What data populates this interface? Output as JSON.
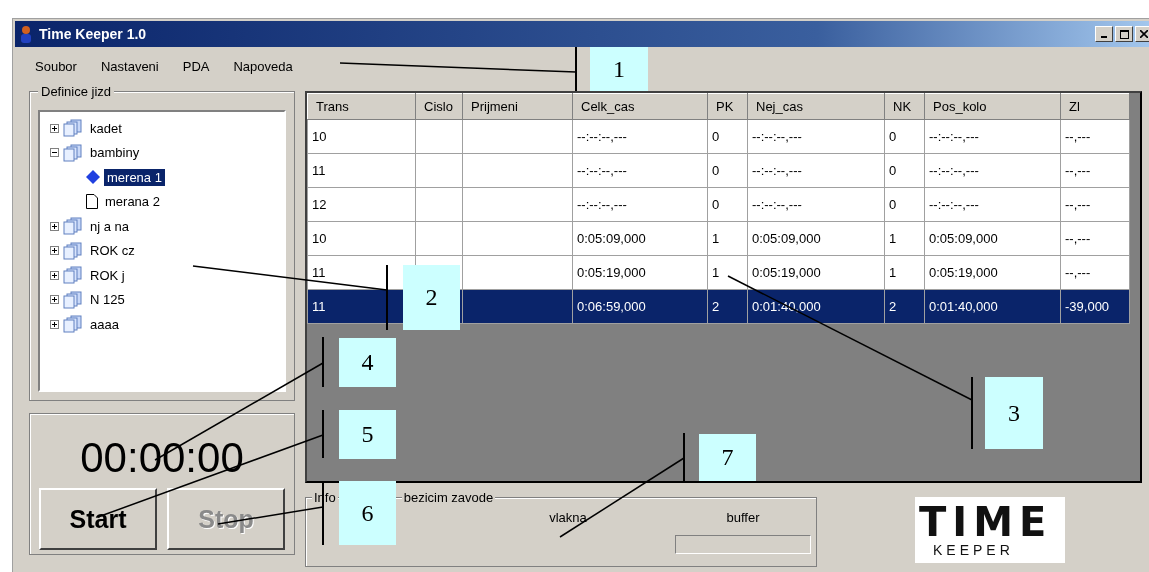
{
  "window": {
    "title": "Time Keeper 1.0"
  },
  "menu": [
    {
      "label": "Soubor"
    },
    {
      "label": "Nastaveni"
    },
    {
      "label": "PDA"
    },
    {
      "label": "Napoveda"
    }
  ],
  "tree_group": {
    "title": "Definice jizd",
    "items": [
      {
        "label": "kadet",
        "kind": "folder",
        "expanded": false,
        "selected": false
      },
      {
        "label": "bambiny",
        "kind": "folder",
        "expanded": true,
        "selected": false,
        "children": [
          {
            "label": "merena 1",
            "kind": "measurement",
            "selected": true
          },
          {
            "label": "merana 2",
            "kind": "page",
            "selected": false
          }
        ]
      },
      {
        "label": "nj a na",
        "kind": "folder",
        "expanded": false,
        "selected": false
      },
      {
        "label": "ROK cz",
        "kind": "folder",
        "expanded": false,
        "selected": false
      },
      {
        "label": "ROK j",
        "kind": "folder",
        "expanded": false,
        "selected": false
      },
      {
        "label": "N 125",
        "kind": "folder",
        "expanded": false,
        "selected": false
      },
      {
        "label": "aaaa",
        "kind": "folder",
        "expanded": false,
        "selected": false
      }
    ]
  },
  "timer": {
    "display": "00:00:00",
    "buttons": [
      {
        "label": "Start",
        "disabled": false
      },
      {
        "label": "Stop",
        "disabled": true
      }
    ]
  },
  "table": {
    "columns": [
      "Trans",
      "Cislo",
      "Prijmeni",
      "Celk_cas",
      "PK",
      "Nej_cas",
      "NK",
      "Pos_kolo",
      "Zl"
    ],
    "rows": [
      {
        "selected": false,
        "cells": [
          "10",
          "",
          "",
          "--:--:--,---",
          "0",
          "--:--:--,---",
          "0",
          "--:--:--,---",
          "--,---"
        ]
      },
      {
        "selected": false,
        "cells": [
          "11",
          "",
          "",
          "--:--:--,---",
          "0",
          "--:--:--,---",
          "0",
          "--:--:--,---",
          "--,---"
        ]
      },
      {
        "selected": false,
        "cells": [
          "12",
          "",
          "",
          "--:--:--,---",
          "0",
          "--:--:--,---",
          "0",
          "--:--:--,---",
          "--,---"
        ]
      },
      {
        "selected": false,
        "cells": [
          "10",
          "",
          "",
          "0:05:09,000",
          "1",
          "0:05:09,000",
          "1",
          "0:05:09,000",
          "--,---"
        ]
      },
      {
        "selected": false,
        "cells": [
          "11",
          "",
          "",
          "0:05:19,000",
          "1",
          "0:05:19,000",
          "1",
          "0:05:19,000",
          "--,---"
        ]
      },
      {
        "selected": true,
        "cells": [
          "11",
          "",
          "",
          "0:06:59,000",
          "2",
          "0:01:40,000",
          "2",
          "0:01:40,000",
          "-39,000"
        ]
      }
    ]
  },
  "info_group": {
    "title_parts": [
      "Info",
      "bezicim zavode"
    ],
    "threads_label": "vlakna",
    "buffer_label": "buffer"
  },
  "logo": {
    "top": "TIME",
    "bottom": "KEEPER"
  },
  "callouts": [
    "1",
    "2",
    "3",
    "4",
    "5",
    "6",
    "7"
  ]
}
